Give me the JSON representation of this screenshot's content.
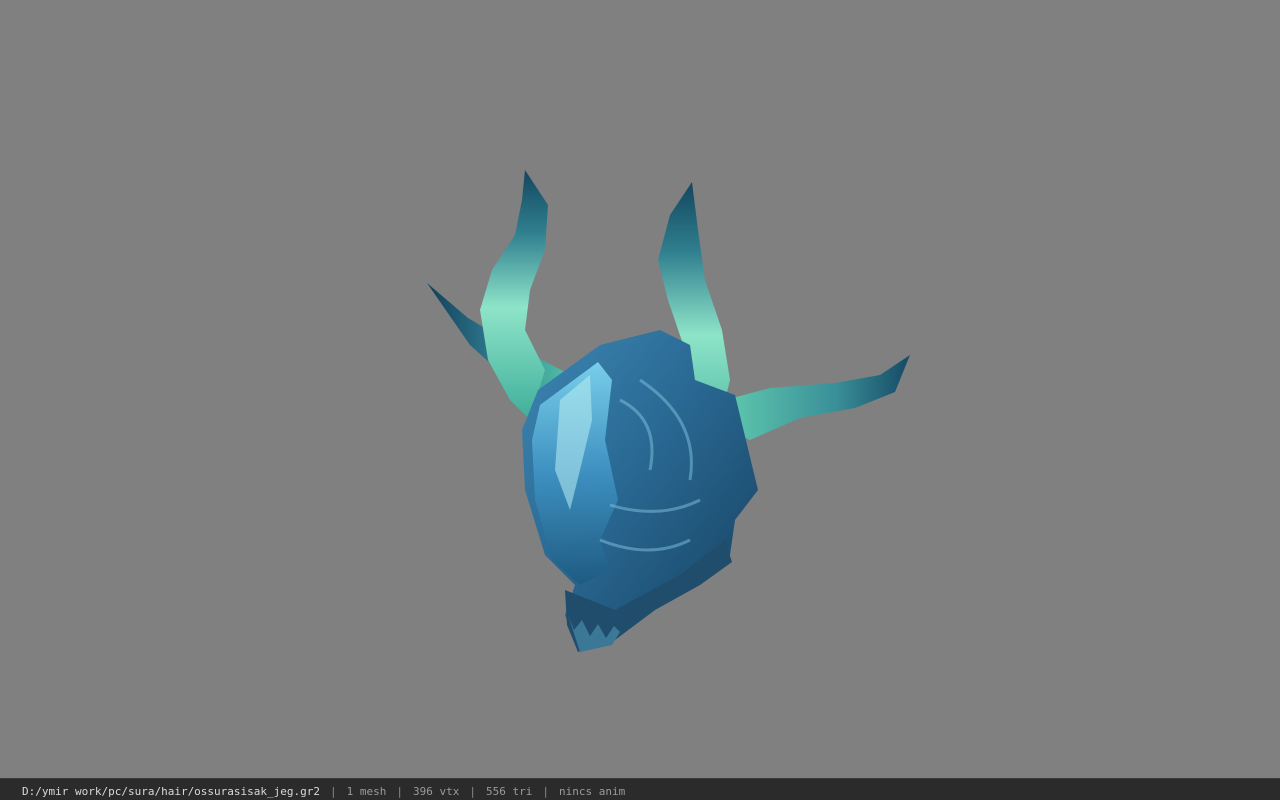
{
  "viewport": {
    "background": "#808080",
    "model_icon": "horned-helmet-model"
  },
  "statusbar": {
    "path": "D:/ymir work/pc/sura/hair/ossurasisak_jeg.gr2",
    "separator": "|",
    "mesh": "1 mesh",
    "vertices": "396 vtx",
    "triangles": "556 tri",
    "anim": "nincs anim"
  },
  "colors": {
    "statusbar_bg": "#2b2b2b",
    "helmet_blue": "#2f6f9a",
    "horn_green": "#6fd6b8",
    "horn_tip": "#1c4f66"
  }
}
